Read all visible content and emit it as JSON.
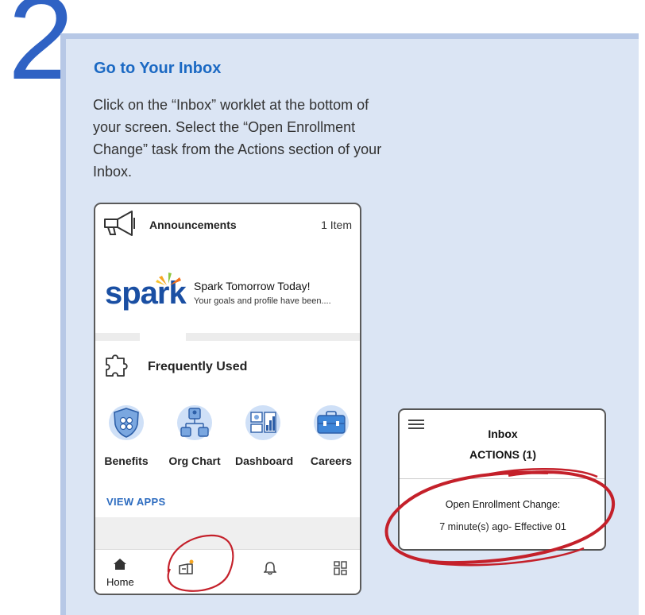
{
  "step": {
    "number": "2"
  },
  "instruction": {
    "heading": "Go to Your Inbox",
    "body": "Click on the “Inbox” worklet at the bottom of your screen. Select the “Open Enrollment Change” task from the Actions section of your Inbox."
  },
  "phone": {
    "announcements": {
      "title": "Announcements",
      "count": "1 Item",
      "icon": "megaphone-icon"
    },
    "spark": {
      "logo_text": "spark",
      "title": "Spark Tomorrow Today!",
      "subtitle": "Your goals and profile have been...."
    },
    "frequently_used": {
      "title": "Frequently Used",
      "icon": "puzzle-icon",
      "apps": [
        {
          "label": "Benefits",
          "icon": "shield-icon"
        },
        {
          "label": "Org Chart",
          "icon": "org-chart-icon"
        },
        {
          "label": "Dashboard",
          "icon": "dashboard-icon"
        },
        {
          "label": "Careers",
          "icon": "briefcase-icon"
        }
      ],
      "view_apps": "VIEW APPS"
    },
    "nav": {
      "home_label": "Home"
    }
  },
  "inbox": {
    "title": "Inbox",
    "actions": "ACTIONS (1)",
    "task_title": "Open Enrollment Change:",
    "task_meta": "7 minute(s) ago- Effective 01"
  },
  "colors": {
    "accent_blue": "#1b69c3",
    "panel_bg": "#dbe5f4",
    "highlight_red": "#c4202a"
  }
}
